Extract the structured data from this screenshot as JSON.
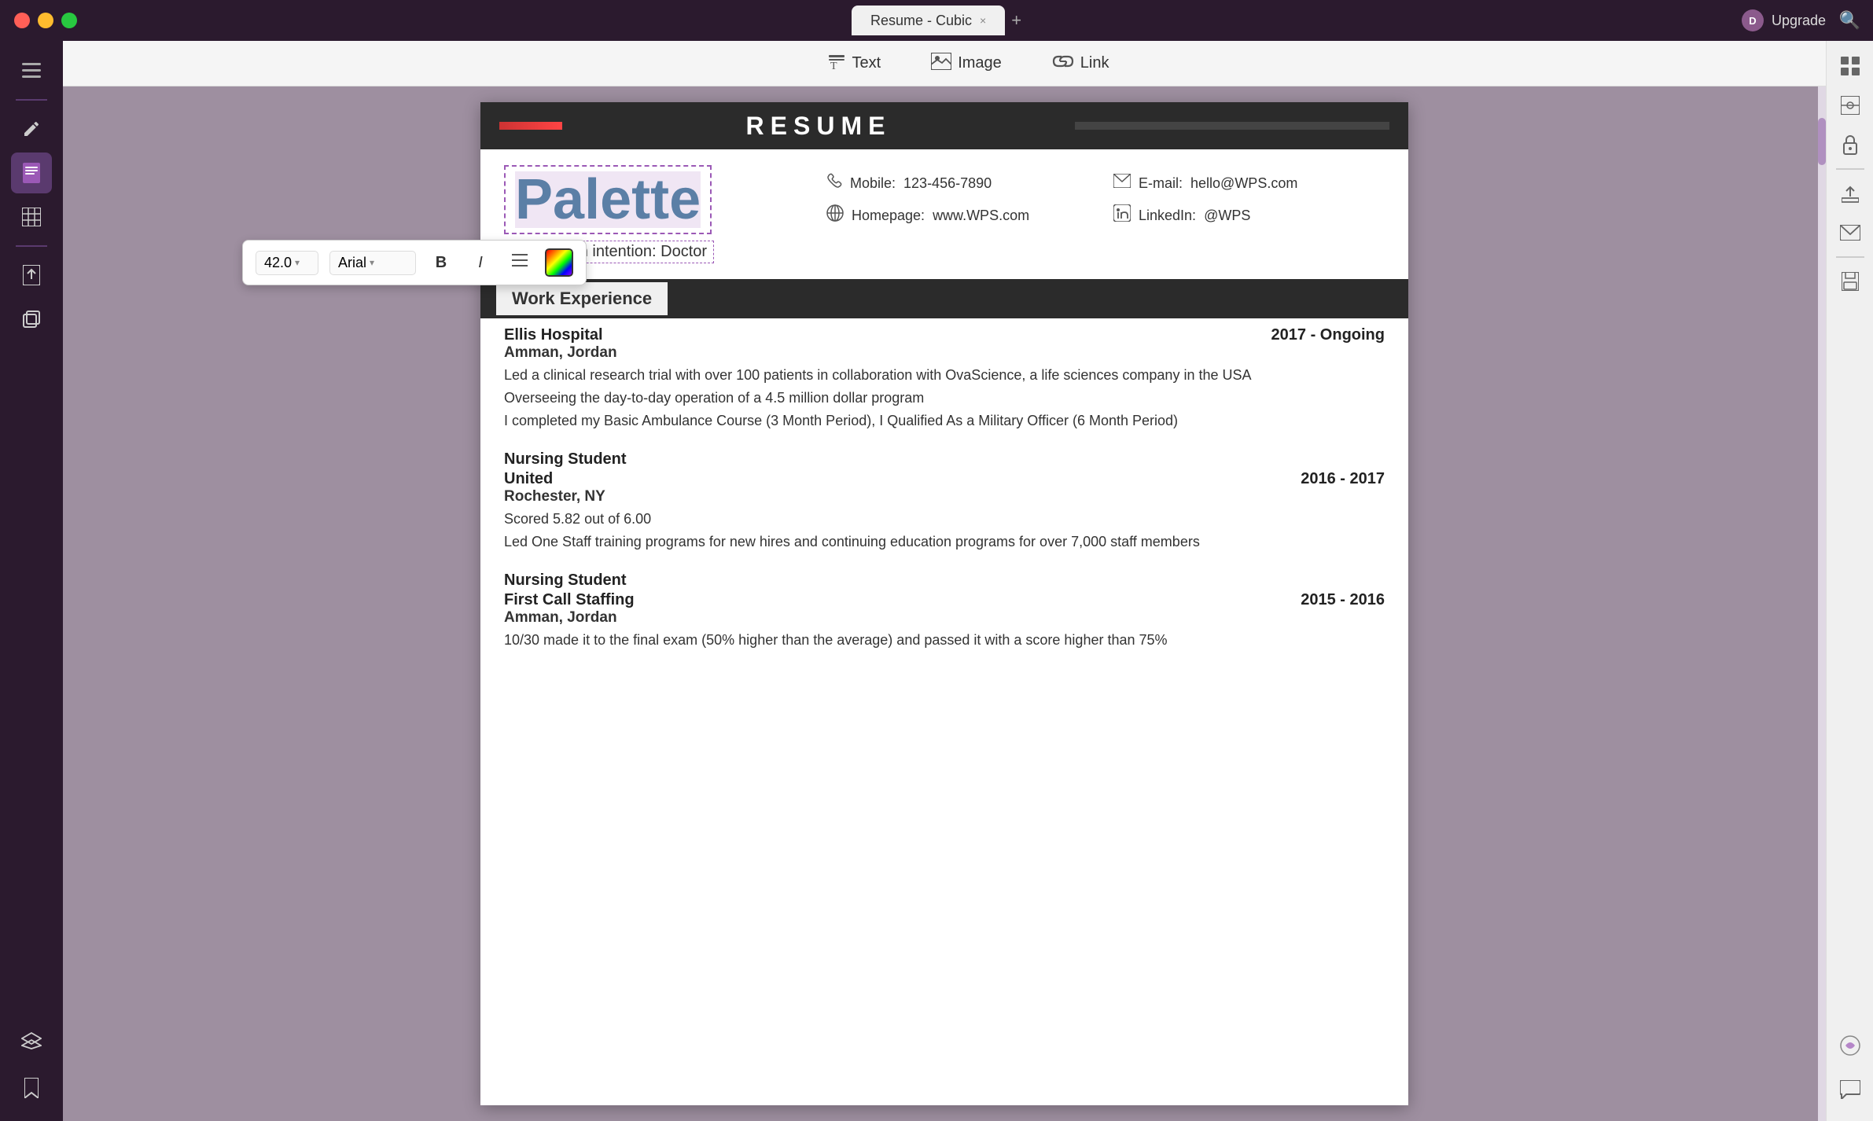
{
  "titlebar": {
    "tab_label": "Resume - Cubic",
    "tab_close": "×",
    "tab_add": "+",
    "upgrade_label": "Upgrade",
    "upgrade_avatar": "D"
  },
  "toolbar": {
    "text_label": "Text",
    "image_label": "Image",
    "link_label": "Link"
  },
  "sidebar_left": {
    "icons": [
      "≡",
      "✏",
      "☰",
      "⚑",
      "▦",
      "◫"
    ]
  },
  "sidebar_right": {
    "icons": [
      "⊞",
      "◈",
      "🔒",
      "↑",
      "✉",
      "—",
      "💾",
      "—",
      "🤖",
      "✉"
    ]
  },
  "format_toolbar": {
    "font_size": "42.0",
    "font_family": "Arial",
    "bold": "B",
    "italic": "I",
    "list": "≡",
    "chevron": "▾"
  },
  "resume": {
    "title": "RESUME",
    "name": "Palette",
    "job_intention_label": "Job search intention:",
    "job_intention_value": "Doctor",
    "contact": {
      "mobile_label": "Mobile:",
      "mobile_value": "123-456-7890",
      "email_label": "E-mail:",
      "email_value": "hello@WPS.com",
      "homepage_label": "Homepage:",
      "homepage_value": "www.WPS.com",
      "linkedin_label": "LinkedIn:",
      "linkedin_value": "@WPS"
    },
    "sections": [
      {
        "title": "Work Experience",
        "items": [
          {
            "company": "Ellis Hospital",
            "date": "2017 - Ongoing",
            "location": "Amman,  Jordan",
            "descriptions": [
              "Led a  clinical research trial with over 100 patients in collaboration with OvaScience, a life sciences company in the USA",
              "Overseeing the day-to-day operation of a 4.5 million dollar program",
              "I completed my Basic Ambulance Course (3 Month Period), I Qualified As a Military Officer (6 Month Period)"
            ]
          },
          {
            "role": "Nursing Student",
            "company": "United",
            "date": "2016 - 2017",
            "location": "Rochester, NY",
            "descriptions": [
              "Scored 5.82 out of 6.00",
              "Led  One  Staff  training  programs  for  new hires and continuing education programs for over 7,000 staff members"
            ]
          },
          {
            "role": "Nursing Student",
            "company": "First Call Staffing",
            "date": "2015 - 2016",
            "location": "Amman,  Jordan",
            "descriptions": [
              "10/30  made it to the final exam (50% higher than the average) and passed it with a score  higher than 75%"
            ]
          }
        ]
      }
    ]
  }
}
